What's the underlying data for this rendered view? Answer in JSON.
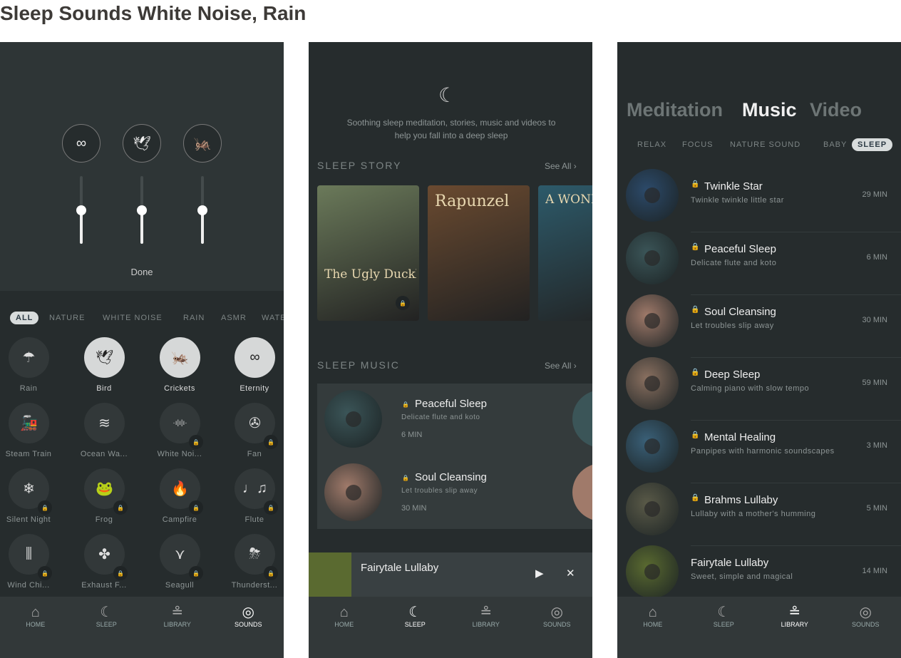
{
  "title": "Sleep Sounds White Noise, Rain",
  "nav": [
    {
      "label": "HOME",
      "icon": "home-icon"
    },
    {
      "label": "SLEEP",
      "icon": "moon-icon"
    },
    {
      "label": "LIBRARY",
      "icon": "stones-icon"
    },
    {
      "label": "SOUNDS",
      "icon": "sounds-icon"
    }
  ],
  "sounds": {
    "mixer": [
      {
        "icon": "infinity-icon",
        "glyph": "∞",
        "level": 0.5
      },
      {
        "icon": "bird-icon",
        "glyph": "🕊",
        "level": 0.5
      },
      {
        "icon": "cricket-icon",
        "glyph": "🦗",
        "level": 0.5
      }
    ],
    "done": "Done",
    "chips": [
      "ALL",
      "NATURE",
      "WHITE NOISE",
      "RAIN",
      "ASMR",
      "WATE"
    ],
    "selected_chip": "ALL",
    "items": [
      {
        "label": "Rain",
        "glyph": "☂",
        "icon": "rain-cloud-icon",
        "active": false,
        "locked": false
      },
      {
        "label": "Bird",
        "glyph": "🕊",
        "icon": "bird-icon",
        "active": true,
        "locked": false
      },
      {
        "label": "Crickets",
        "glyph": "🦗",
        "icon": "cricket-icon",
        "active": true,
        "locked": false
      },
      {
        "label": "Eternity",
        "glyph": "∞",
        "icon": "infinity-icon",
        "active": true,
        "locked": false
      },
      {
        "label": "Steam Train",
        "glyph": "🚂",
        "icon": "train-icon",
        "active": false,
        "locked": false
      },
      {
        "label": "Ocean Wa...",
        "glyph": "≋",
        "icon": "wave-icon",
        "active": false,
        "locked": false
      },
      {
        "label": "White Noi...",
        "glyph": "·ı|ı|ı·",
        "icon": "soundwave-icon",
        "active": false,
        "locked": true
      },
      {
        "label": "Fan",
        "glyph": "✇",
        "icon": "fan-icon",
        "active": false,
        "locked": true
      },
      {
        "label": "Silent Night",
        "glyph": "❄",
        "icon": "snowflake-icon",
        "active": false,
        "locked": true
      },
      {
        "label": "Frog",
        "glyph": "🐸",
        "icon": "frog-icon",
        "active": false,
        "locked": true
      },
      {
        "label": "Campfire",
        "glyph": "🔥",
        "icon": "flame-icon",
        "active": false,
        "locked": true
      },
      {
        "label": "Flute",
        "glyph": "♩♫",
        "icon": "music-notes-icon",
        "active": false,
        "locked": true
      },
      {
        "label": "Wind Chi...",
        "glyph": "⫼",
        "icon": "wind-chime-icon",
        "active": false,
        "locked": true
      },
      {
        "label": "Exhaust F...",
        "glyph": "✤",
        "icon": "exhaust-fan-icon",
        "active": false,
        "locked": true
      },
      {
        "label": "Seagull",
        "glyph": "⋎",
        "icon": "seagull-icon",
        "active": false,
        "locked": true
      },
      {
        "label": "Thunderst...",
        "glyph": "⛈",
        "icon": "thunderstorm-icon",
        "active": false,
        "locked": true
      }
    ]
  },
  "sleep": {
    "intro": "Soothing sleep meditation, stories, music and videos to help you fall into a deep sleep",
    "story_heading": "SLEEP STORY",
    "music_heading": "SLEEP MUSIC",
    "see_all": "See All ›",
    "books": [
      {
        "title": "The Ugly Duckling",
        "locked": true,
        "color": "#6b7a5a"
      },
      {
        "title": "Rapunzel",
        "locked": false,
        "color": "#6a4a30"
      },
      {
        "title": "A WONDERFUL VOY",
        "locked": false,
        "color": "#2d5a6a"
      }
    ],
    "music": [
      {
        "title": "Peaceful Sleep",
        "subtitle": "Delicate flute and koto",
        "duration": "6 MIN",
        "locked": true,
        "color": "#3b5558"
      },
      {
        "title": "Soul Cleansing",
        "subtitle": "Let troubles slip away",
        "duration": "30 MIN",
        "locked": true,
        "color": "#a07a6a"
      }
    ],
    "player": {
      "title": "Fairytale Lullaby",
      "play": "▶",
      "close": "✕"
    }
  },
  "library": {
    "tabs": [
      "Meditation",
      "Music",
      "Video"
    ],
    "active_tab": "Music",
    "chips": [
      "RELAX",
      "FOCUS",
      "NATURE SOUND",
      "BABY",
      "SLEEP"
    ],
    "selected_chip": "SLEEP",
    "tracks": [
      {
        "title": "Twinkle Star",
        "subtitle": "Twinkle twinkle little star",
        "duration": "29 MIN",
        "locked": true,
        "color": "#2c4a6a"
      },
      {
        "title": "Peaceful Sleep",
        "subtitle": "Delicate flute and koto",
        "duration": "6 MIN",
        "locked": true,
        "color": "#3b5558"
      },
      {
        "title": "Soul Cleansing",
        "subtitle": "Let troubles slip away",
        "duration": "30 MIN",
        "locked": true,
        "color": "#a07a6a"
      },
      {
        "title": "Deep Sleep",
        "subtitle": "Calming piano with slow tempo",
        "duration": "59 MIN",
        "locked": true,
        "color": "#8a7060"
      },
      {
        "title": "Mental Healing",
        "subtitle": "Panpipes with harmonic soundscapes",
        "duration": "3 MIN",
        "locked": true,
        "color": "#3a6078"
      },
      {
        "title": "Brahms Lullaby",
        "subtitle": "Lullaby with a mother's humming",
        "duration": "5 MIN",
        "locked": true,
        "color": "#5a5a48"
      },
      {
        "title": "Fairytale Lullaby",
        "subtitle": "Sweet, simple and magical",
        "duration": "14 MIN",
        "locked": false,
        "color": "#5a6a30"
      }
    ]
  }
}
